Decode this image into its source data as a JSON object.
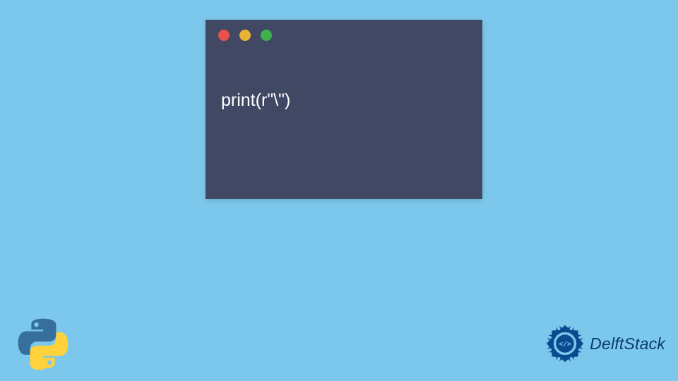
{
  "code_window": {
    "traffic_lights": [
      "red",
      "yellow",
      "green"
    ],
    "code": "print(r\"\\\")"
  },
  "icons": {
    "python_logo": "python-logo",
    "brand_badge": "delftstack-badge"
  },
  "brand": {
    "name": "DelftStack"
  },
  "colors": {
    "background": "#7cc8ed",
    "window": "#414863",
    "code_text": "#ffffff",
    "brand_text": "#0b3a6b",
    "python_blue": "#366e9d",
    "python_yellow": "#ffd23c",
    "badge_blue": "#0a4a8f"
  }
}
